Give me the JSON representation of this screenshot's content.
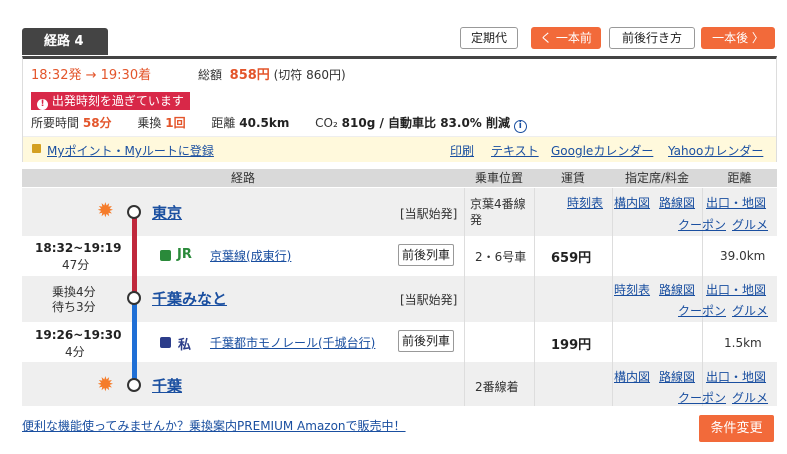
{
  "tab": {
    "label": "経路 4"
  },
  "top_buttons": {
    "teiki": "定期代",
    "prev": "く 一本前",
    "around": "前後行き方",
    "next": "一本後 〉"
  },
  "summary": {
    "time": "18:32発 → 19:30着",
    "fare_label": "総額",
    "fare_value": "858円",
    "fare_ticket": "(切符 860円)",
    "warning": "出発時刻を過ぎています",
    "duration_label": "所要時間",
    "duration_value": "58分",
    "transfer_label": "乗換",
    "transfer_value": "1回",
    "distance_label": "距離",
    "distance_value": "40.5km",
    "co2_label": "CO₂",
    "co2_value": "810g / 自動車比 83.0% 削減"
  },
  "links_bar": {
    "myroute": "Myポイント・Myルートに登録",
    "print": "印刷",
    "text": "テキスト",
    "google": "Googleカレンダー",
    "yahoo": "Yahooカレンダー"
  },
  "table_headers": {
    "route": "経路",
    "position": "乗車位置",
    "fare": "運賃",
    "seat": "指定席/料金",
    "distance": "距離"
  },
  "stations": [
    {
      "name": "東京",
      "note": "[当駅始発]",
      "position": "京葉4番線発",
      "links": [
        "時刻表",
        "構内図",
        "路線図",
        "出口・地図",
        "クーポン",
        "グルメ"
      ]
    },
    {
      "name": "千葉みなと",
      "note": "[当駅始発]",
      "transfer": "乗換4分",
      "wait": "待ち3分",
      "links": [
        "時刻表",
        "路線図",
        "出口・地図",
        "クーポン",
        "グルメ"
      ]
    },
    {
      "name": "千葉",
      "position": "2番線着",
      "links": [
        "構内図",
        "路線図",
        "出口・地図",
        "クーポン",
        "グルメ"
      ]
    }
  ],
  "segments": [
    {
      "time": "18:32~19:19",
      "duration": "47分",
      "operator": "JR",
      "line": "京葉線(成東行)",
      "button": "前後列車",
      "position": "2・6号車",
      "fare": "659円",
      "distance": "39.0km",
      "color": "#c0283c"
    },
    {
      "time": "19:26~19:30",
      "duration": "4分",
      "operator": "私",
      "line": "千葉都市モノレール(千城台行)",
      "button": "前後列車",
      "fare": "199円",
      "distance": "1.5km",
      "color": "#1f6fd6"
    }
  ],
  "footer": {
    "promo": "便利な機能使ってみませんか？乗換案内PREMIUM Amazonで販売中！",
    "change": "条件変更"
  },
  "colors": {
    "accent": "#f26a3a",
    "warning": "#d82848",
    "sun": "#f57c2b"
  }
}
